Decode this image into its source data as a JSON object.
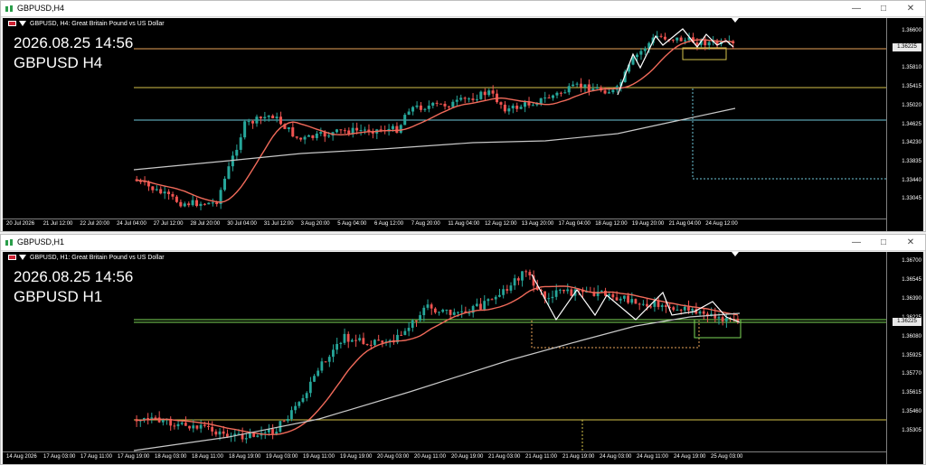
{
  "windows": [
    {
      "title": "GBPUSD,H4",
      "info": "GBPUSD, H4:  Great Britain Pound vs US Dollar",
      "overlay_datetime": "2026.08.25 14:56",
      "overlay_symbol": "GBPUSD H4",
      "price_ticks": [
        "1.36600",
        "1.36225",
        "1.35810",
        "1.35415",
        "1.35020",
        "1.34625",
        "1.34230",
        "1.33835",
        "1.33440",
        "1.33045"
      ],
      "current_price": "1.36225",
      "time_ticks": [
        "20 Jul 2026",
        "21 Jul 12:00",
        "22 Jul 20:00",
        "24 Jul 04:00",
        "27 Jul 12:00",
        "28 Jul 20:00",
        "30 Jul 04:00",
        "31 Jul 12:00",
        "3 Aug 20:00",
        "5 Aug 04:00",
        "6 Aug 12:00",
        "7 Aug 20:00",
        "11 Aug 04:00",
        "12 Aug 12:00",
        "13 Aug 20:00",
        "17 Aug 04:00",
        "18 Aug 12:00",
        "19 Aug 20:00",
        "21 Aug 04:00",
        "24 Aug 12:00"
      ]
    },
    {
      "title": "GBPUSD,H1",
      "info": "GBPUSD, H1:  Great Britain Pound vs US Dollar",
      "overlay_datetime": "2026.08.25 14:56",
      "overlay_symbol": "GBPUSD H1",
      "price_ticks": [
        "1.36700",
        "1.36545",
        "1.36390",
        "1.36225",
        "1.36080",
        "1.35925",
        "1.35770",
        "1.35615",
        "1.35460",
        "1.35305"
      ],
      "current_price": "1.36225",
      "time_ticks": [
        "14 Aug 2026",
        "17 Aug 03:00",
        "17 Aug 11:00",
        "17 Aug 19:00",
        "18 Aug 03:00",
        "18 Aug 11:00",
        "18 Aug 19:00",
        "19 Aug 03:00",
        "19 Aug 11:00",
        "19 Aug 19:00",
        "20 Aug 03:00",
        "20 Aug 11:00",
        "20 Aug 19:00",
        "21 Aug 03:00",
        "21 Aug 11:00",
        "21 Aug 19:00",
        "24 Aug 03:00",
        "24 Aug 11:00",
        "24 Aug 19:00",
        "25 Aug 03:00"
      ]
    }
  ],
  "buttons": {
    "minimize": "—",
    "restore": "□",
    "close": "✕"
  },
  "colors": {
    "bull": "#26a69a",
    "bear": "#ef5350",
    "ma_fast": "#f06a5a",
    "ma_slow": "#c8c8c8",
    "hline_orange": "#e8a35a",
    "hline_yellow": "#d4c24a",
    "hline_cyan": "#6ec6d8",
    "hline_green": "#7ed957"
  }
}
